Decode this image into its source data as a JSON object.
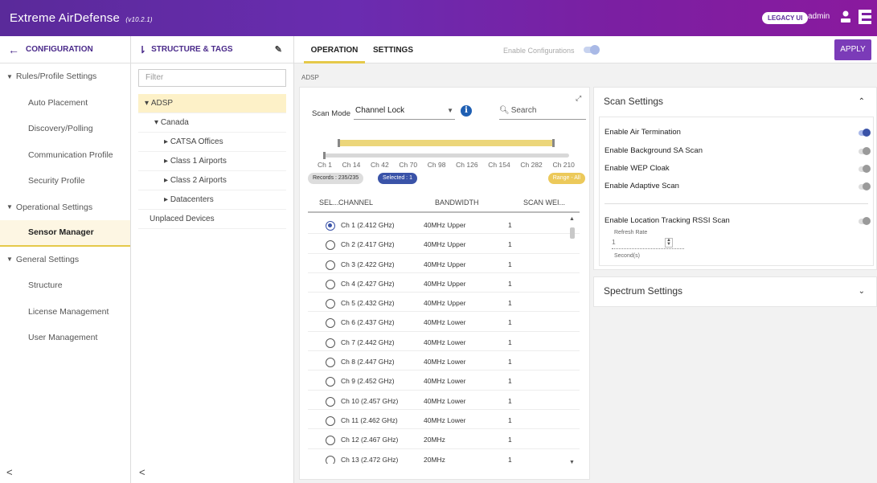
{
  "app": {
    "title": "Extreme AirDefense",
    "version": "(v10.2.1)",
    "legacy_label": "LEGACY UI",
    "user": "admin"
  },
  "leftnav": {
    "heading": "CONFIGURATION",
    "items": [
      {
        "label": "Rules/Profile Settings",
        "type": "group"
      },
      {
        "label": "Auto Placement",
        "type": "sub"
      },
      {
        "label": "Discovery/Polling",
        "type": "sub"
      },
      {
        "label": "Communication Profile",
        "type": "sub"
      },
      {
        "label": "Security Profile",
        "type": "sub"
      },
      {
        "label": "Operational Settings",
        "type": "group"
      },
      {
        "label": "Sensor Manager",
        "type": "active"
      },
      {
        "label": "General Settings",
        "type": "group"
      },
      {
        "label": "Structure",
        "type": "sub"
      },
      {
        "label": "License Management",
        "type": "sub"
      },
      {
        "label": "User Management",
        "type": "sub"
      }
    ],
    "collapse": "<"
  },
  "structure": {
    "heading": "STRUCTURE & TAGS",
    "filter_placeholder": "Filter",
    "tree": [
      {
        "label": "ADSP",
        "prefix": "▾ ",
        "indent": 8,
        "selected": true
      },
      {
        "label": "Canada",
        "prefix": "▾ ",
        "indent": 20,
        "selected": false
      },
      {
        "label": "CATSA Offices",
        "prefix": "▸ ",
        "indent": 32,
        "selected": false
      },
      {
        "label": "Class 1 Airports",
        "prefix": "▸ ",
        "indent": 32,
        "selected": false
      },
      {
        "label": "Class 2 Airports",
        "prefix": "▸ ",
        "indent": 32,
        "selected": false
      },
      {
        "label": "Datacenters",
        "prefix": "▸ ",
        "indent": 32,
        "selected": false
      },
      {
        "label": "Unplaced Devices",
        "prefix": "",
        "indent": 14,
        "selected": false
      }
    ],
    "collapse": "<"
  },
  "tabs": {
    "operation": "OPERATION",
    "settings": "SETTINGS"
  },
  "enable_configurations": "Enable Configurations",
  "apply": "APPLY",
  "breadcrumb": "ADSP",
  "channels": {
    "scan_mode_label": "Scan Mode",
    "scan_mode_value": "Channel Lock",
    "search_placeholder": "Search",
    "channel_ticks": [
      "Ch 1",
      "Ch 14",
      "Ch 42",
      "Ch 70",
      "Ch 98",
      "Ch 126",
      "Ch 154",
      "Ch 282",
      "Ch 210"
    ],
    "records": "Records : 235/235",
    "selected": "Selected : 1",
    "range": "Range - All",
    "columns": {
      "select": "SEL...",
      "channel": "CHANNEL",
      "bandwidth": "BANDWIDTH",
      "scan_weight": "SCAN WEI..."
    },
    "rows": [
      {
        "channel": "Ch 1 (2.412 GHz)",
        "bandwidth": "40MHz Upper",
        "weight": "1",
        "selected": true
      },
      {
        "channel": "Ch 2 (2.417 GHz)",
        "bandwidth": "40MHz Upper",
        "weight": "1",
        "selected": false
      },
      {
        "channel": "Ch 3 (2.422 GHz)",
        "bandwidth": "40MHz Upper",
        "weight": "1",
        "selected": false
      },
      {
        "channel": "Ch 4 (2.427 GHz)",
        "bandwidth": "40MHz Upper",
        "weight": "1",
        "selected": false
      },
      {
        "channel": "Ch 5 (2.432 GHz)",
        "bandwidth": "40MHz Upper",
        "weight": "1",
        "selected": false
      },
      {
        "channel": "Ch 6 (2.437 GHz)",
        "bandwidth": "40MHz Lower",
        "weight": "1",
        "selected": false
      },
      {
        "channel": "Ch 7 (2.442 GHz)",
        "bandwidth": "40MHz Lower",
        "weight": "1",
        "selected": false
      },
      {
        "channel": "Ch 8 (2.447 GHz)",
        "bandwidth": "40MHz Lower",
        "weight": "1",
        "selected": false
      },
      {
        "channel": "Ch 9 (2.452 GHz)",
        "bandwidth": "40MHz Lower",
        "weight": "1",
        "selected": false
      },
      {
        "channel": "Ch 10 (2.457 GHz)",
        "bandwidth": "40MHz Lower",
        "weight": "1",
        "selected": false
      },
      {
        "channel": "Ch 11 (2.462 GHz)",
        "bandwidth": "40MHz Lower",
        "weight": "1",
        "selected": false
      },
      {
        "channel": "Ch 12 (2.467 GHz)",
        "bandwidth": "20MHz",
        "weight": "1",
        "selected": false
      },
      {
        "channel": "Ch 13 (2.472 GHz)",
        "bandwidth": "20MHz",
        "weight": "1",
        "selected": false
      }
    ]
  },
  "scan_settings": {
    "title": "Scan Settings",
    "air_termination": "Enable Air Termination",
    "background_sa": "Enable Background SA Scan",
    "wep_cloak": "Enable WEP Cloak",
    "adaptive_scan": "Enable Adaptive Scan",
    "location_tracking": "Enable Location Tracking RSSI Scan",
    "refresh_rate_label": "Refresh Rate",
    "refresh_rate_value": "1",
    "refresh_rate_unit": "Second(s)"
  },
  "spectrum_settings": {
    "title": "Spectrum Settings"
  }
}
